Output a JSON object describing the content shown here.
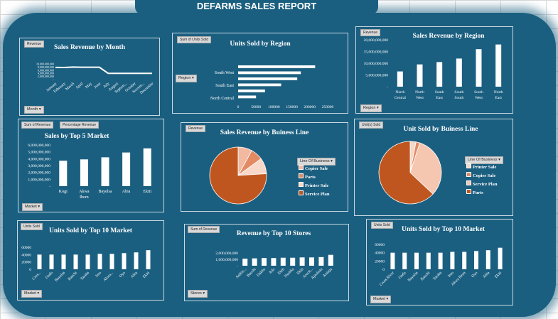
{
  "report_title": "DEFARMS SALES REPORT",
  "controls": {
    "revenue": "Revenue",
    "sum_of_revenue": "Sum of Revenue",
    "percentage_revenue": "Percentage Revenue",
    "sum_units_sold": "Sum of Units Sold",
    "units_sold": "Units Sold",
    "units_sold_alt": "Unit(s) Sold",
    "month_dd": "Month",
    "region_dd": "Region",
    "market_dd": "Market",
    "stores_dd": "Stores",
    "line_of_business_dd": "Line Of Business"
  },
  "colors": {
    "panel": "#1b5f80",
    "bar": "#ffffff",
    "accent": "#c0561f"
  },
  "chart_data": [
    {
      "id": "revenue_by_month",
      "type": "line",
      "title": "Sales Revenue by Month",
      "categories": [
        "January",
        "February",
        "March",
        "April",
        "May",
        "June",
        "July",
        "August",
        "Septem...",
        "October",
        "Novem...",
        "December"
      ],
      "values": [
        7800000000,
        7700000000,
        8000000000,
        7900000000,
        7900000000,
        7900000000,
        4000000000,
        4000000000,
        4000000000,
        4000000000,
        4000000000,
        4000000000
      ],
      "yticks": [
        "10,000,000,000",
        "8,000,000,000",
        "6,000,000,000",
        "4,000,000,000",
        "2,000,000,000",
        "-"
      ],
      "ylim": [
        0,
        10000000000
      ]
    },
    {
      "id": "units_by_region",
      "type": "bar",
      "orientation": "horizontal",
      "title": "Units Sold by Region",
      "categories": [
        "South West",
        "South East",
        "North Central"
      ],
      "bar_values": [
        215000,
        175000,
        165000,
        120000,
        75000,
        50000
      ],
      "xticks": [
        "0",
        "50000",
        "100000",
        "150000",
        "200000",
        "250000"
      ],
      "xlim": [
        0,
        250000
      ]
    },
    {
      "id": "revenue_by_region",
      "type": "bar",
      "title": "Sales Revenue by Region",
      "categories": [
        "North Central",
        "North West",
        "South East",
        "South South",
        "South West",
        "North East"
      ],
      "values": [
        6500000000,
        9500000000,
        10500000000,
        12000000000,
        16000000000,
        18000000000
      ],
      "yticks": [
        "20,000,000,000",
        "15,000,000,000",
        "10,000,000,000",
        "5,000,000,000",
        "-"
      ],
      "ylim": [
        0,
        20000000000
      ]
    },
    {
      "id": "sales_top5_market",
      "type": "bar",
      "title": "Sales by Top 5 Market",
      "categories": [
        "Kogi",
        "Akwa Ibom",
        "Bayelsa",
        "Abia",
        "Ekiti"
      ],
      "values": [
        3700000000,
        3900000000,
        4200000000,
        4900000000,
        5500000000
      ],
      "yticks": [
        "6,000,000,000",
        "5,000,000,000",
        "4,000,000,000",
        "3,000,000,000",
        "2,000,000,000",
        "1,000,000,000",
        "-"
      ],
      "ylim": [
        0,
        6000000000
      ]
    },
    {
      "id": "revenue_by_business_line",
      "type": "pie",
      "title": "Sales Revenue by Buiness Line",
      "labels": [
        "Copier Sale",
        "Parts",
        "Printer Sale",
        "Service Plan"
      ],
      "values": [
        8,
        7,
        9,
        76
      ],
      "colors": [
        "#f2b8a0",
        "#e38a63",
        "#f8d8c8",
        "#c0561f"
      ]
    },
    {
      "id": "units_by_business_line",
      "type": "pie",
      "title": "Unit Sold by Buiness Line",
      "labels": [
        "Printer Sale",
        "Copier Sale",
        "Service Plan",
        "Parts"
      ],
      "values": [
        3,
        2,
        32,
        63
      ],
      "colors": [
        "#f8d8c8",
        "#e38a63",
        "#f6c7b0",
        "#c0561f"
      ]
    },
    {
      "id": "units_top10_market_a",
      "type": "bar",
      "title": "Units Sold by Top 10 Market",
      "categories": [
        "Cros...",
        "Ondo",
        "Bayelsa",
        "Bauchi",
        "Taraba",
        "Imo",
        "Akwa...",
        "Oyo",
        "Abia",
        "Ekiti"
      ],
      "values": [
        40000,
        40000,
        40000,
        40000,
        40000,
        42000,
        42000,
        44000,
        46000,
        52000
      ],
      "yticks": [
        "60000",
        "40000",
        "20000",
        "0"
      ],
      "ylim": [
        0,
        60000
      ]
    },
    {
      "id": "revenue_top10_stores",
      "type": "bar",
      "title": "Revenue by Top 10 Stores",
      "categories": [
        "Asikin...",
        "Bauchi",
        "Dakku",
        "Ado",
        "Ekiti",
        "Nsukka",
        "Ekiti",
        "Aroch...",
        "Ajaokuta",
        "Aniapa"
      ],
      "values": [
        1100000000,
        1150000000,
        1200000000,
        1200000000,
        1250000000,
        1250000000,
        1300000000,
        1300000000,
        1350000000,
        1700000000
      ],
      "yticks": [
        "2,000,000,000",
        "1,000,000,000",
        "-"
      ],
      "ylim": [
        0,
        2000000000
      ]
    },
    {
      "id": "units_top10_market_b",
      "type": "bar",
      "title": "Units Sold by Top 10 Market",
      "categories": [
        "Cross River",
        "Ondo",
        "Bayelsa",
        "Bauchi",
        "Taraba",
        "Imo",
        "Akwa Ibom",
        "Oyo",
        "Abia",
        "Ekiti"
      ],
      "values": [
        40000,
        40000,
        40000,
        40000,
        40000,
        42000,
        42000,
        44000,
        46000,
        52000
      ],
      "yticks": [
        "60000",
        "40000",
        "20000",
        "0"
      ],
      "ylim": [
        0,
        60000
      ]
    }
  ]
}
